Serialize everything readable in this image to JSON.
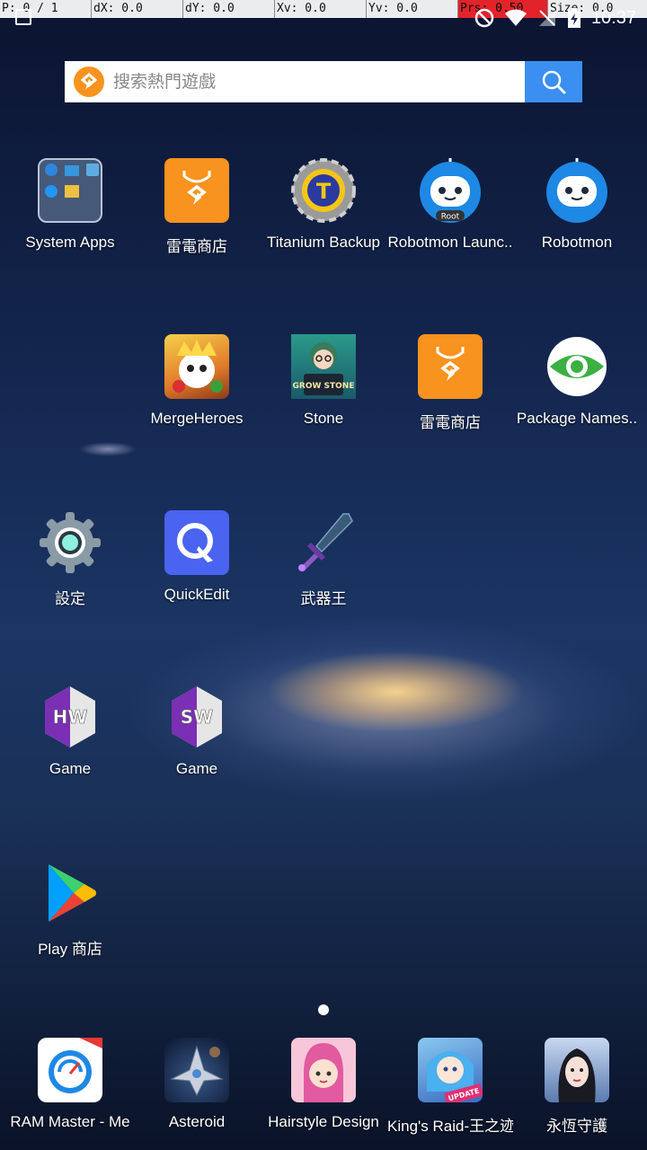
{
  "debug": {
    "p": "P: 0 / 1",
    "dx": "dX: 0.0",
    "dy": "dY: 0.0",
    "xv": "Xv: 0.0",
    "yv": "Yv: 0.0",
    "prs": "Prs: 0.50",
    "size": "Size: 0.0"
  },
  "status": {
    "time": "10:37"
  },
  "search": {
    "placeholder": "搜索熱門遊戲"
  },
  "home": {
    "row1": [
      "System Apps",
      "雷電商店",
      "Titanium Backup",
      "Robotmon Launc..",
      "Robotmon"
    ],
    "row2": [
      "MergeHeroes",
      "Stone",
      "雷電商店",
      "Package Names.."
    ],
    "row3": [
      "設定",
      "QuickEdit",
      "武器王"
    ],
    "row4": [
      "Game",
      "Game"
    ],
    "row5": [
      "Play 商店"
    ]
  },
  "dock": [
    "RAM Master - Me",
    "Asteroid",
    "Hairstyle Design",
    "King's Raid-王之迹",
    "永恆守護"
  ],
  "icons": {
    "robot_badge": "Root",
    "titanium_letter": "T",
    "hw_text": "HW",
    "sw_text": "SW",
    "grow_stone": "GROW STONE",
    "update_badge": "UPDATE"
  }
}
